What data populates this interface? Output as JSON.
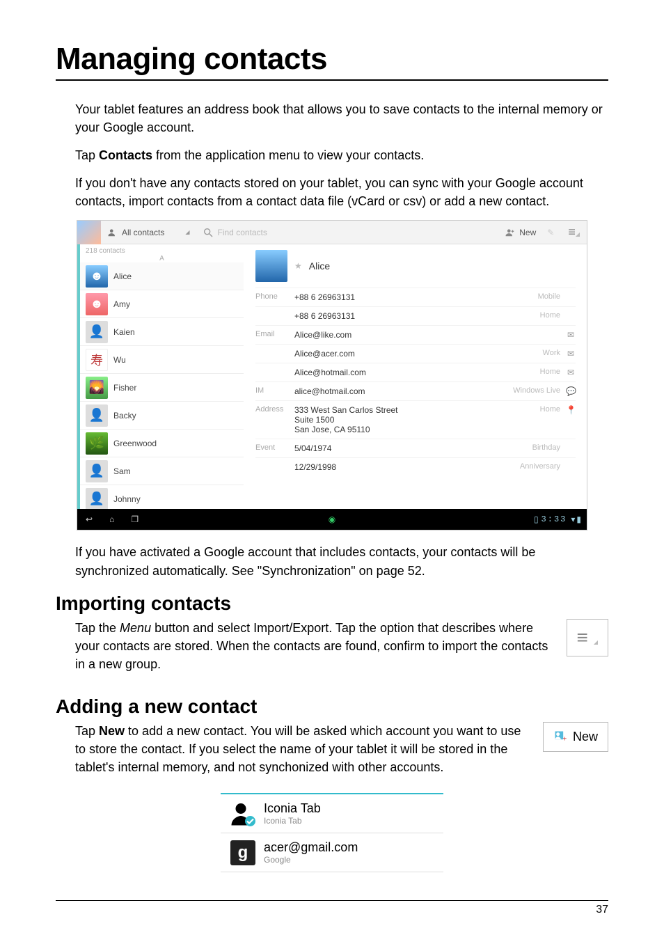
{
  "page_title": "Managing contacts",
  "intro": [
    "Your tablet features an address book that allows you to save contacts to the internal memory or your Google account.",
    "Tap Contacts from the application menu to view your contacts.",
    "If you don't have any contacts stored on your tablet, you can sync with your Google account contacts, import contacts from a contact data file (vCard or csv) or add a new contact."
  ],
  "post_app": "If you have activated a Google account that includes contacts, your contacts will be synchronized automatically. See \"Synchronization\" on page 52.",
  "section_import": {
    "heading": "Importing contacts",
    "body": "Tap the Menu button and select Import/Export. Tap the option that describes where your contacts are stored. When the contacts are found, confirm to import the contacts in a new group."
  },
  "section_add": {
    "heading": "Adding a new contact",
    "body": "Tap New to add a new contact. You will be asked which account you want to use to store the contact. If you select the name of your tablet it will be stored in the tablet's internal memory, and not synchonized with other accounts.",
    "newlabel": "New"
  },
  "accounts": {
    "local": {
      "title": "Iconia Tab",
      "sub": "Iconia Tab"
    },
    "google": {
      "title": "acer@gmail.com",
      "sub": "Google"
    }
  },
  "app": {
    "topbar": {
      "all": "All contacts",
      "search_ph": "Find contacts",
      "new": "New"
    },
    "count": "218 contacts",
    "section_letter": "A",
    "list": [
      "Alice",
      "Amy",
      "Kaien",
      "Wu",
      "Fisher",
      "Backy",
      "Greenwood",
      "Sam",
      "Johnny"
    ],
    "detail": {
      "name": "Alice",
      "fields": [
        {
          "label": "Phone",
          "value": "+88 6 26963131",
          "type": "Mobile",
          "icon": ""
        },
        {
          "label": "",
          "value": "+88 6 26963131",
          "type": "Home",
          "icon": ""
        },
        {
          "label": "Email",
          "value": "Alice@like.com",
          "type": "",
          "icon": "mail"
        },
        {
          "label": "",
          "value": "Alice@acer.com",
          "type": "Work",
          "icon": "mail"
        },
        {
          "label": "",
          "value": "Alice@hotmail.com",
          "type": "Home",
          "icon": "mail"
        },
        {
          "label": "IM",
          "value": "alice@hotmail.com",
          "type": "Windows Live",
          "icon": "chat"
        },
        {
          "label": "Address",
          "value": "333 West San Carlos Street\nSuite 1500\nSan Jose, CA 95110",
          "type": "Home",
          "icon": "pin"
        },
        {
          "label": "Event",
          "value": "5/04/1974",
          "type": "Birthday",
          "icon": ""
        },
        {
          "label": "",
          "value": "12/29/1998",
          "type": "Anniversary",
          "icon": ""
        }
      ]
    },
    "clock": "3:33"
  },
  "pagenum": "37"
}
